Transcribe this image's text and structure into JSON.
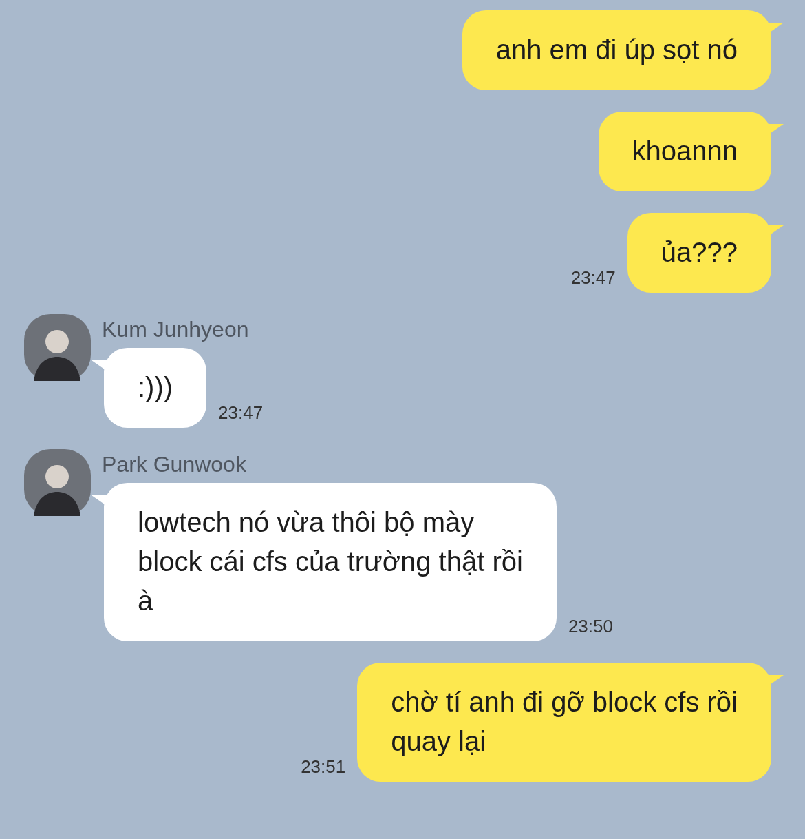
{
  "messages": [
    {
      "kind": "sent",
      "text": "anh em đi úp sọt nó"
    },
    {
      "kind": "sent",
      "text": "khoannn"
    },
    {
      "kind": "sent",
      "text": "ủa???",
      "time": "23:47"
    },
    {
      "kind": "received",
      "sender": "Kum Junhyeon",
      "text": ":)))",
      "time": "23:47"
    },
    {
      "kind": "received",
      "sender": "Park Gunwook",
      "text": "lowtech nó vừa thôi bộ mày\nblock cái cfs của trường thật rồi\nà",
      "time": "23:50"
    },
    {
      "kind": "sent",
      "text": "chờ tí anh đi gỡ block cfs rồi\nquay lại",
      "time": "23:51"
    }
  ]
}
